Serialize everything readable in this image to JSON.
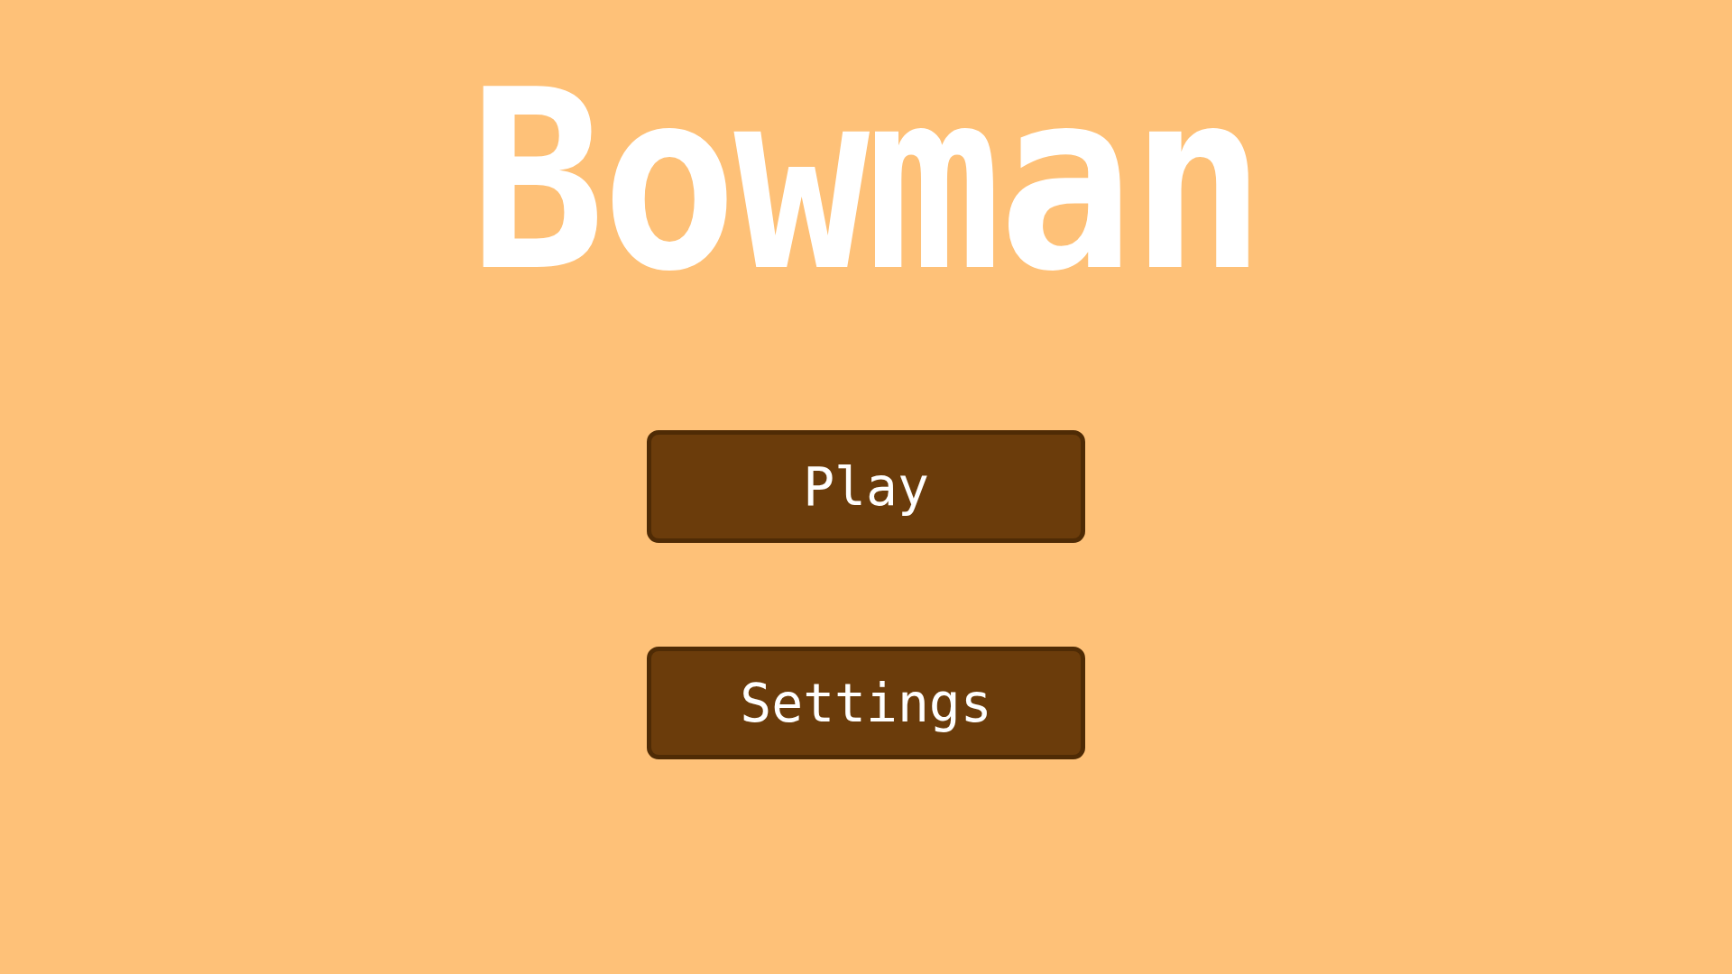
{
  "title": "Bowman",
  "buttons": [
    "Play",
    "Settings"
  ]
}
